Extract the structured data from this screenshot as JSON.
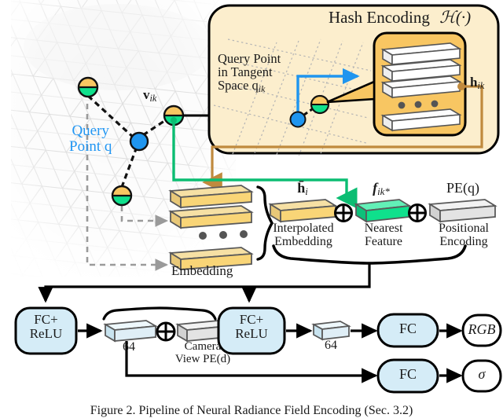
{
  "figure": {
    "caption": "Figure 2.  Pipeline of Neural Radiance Field Encoding (Sec. 3.2)",
    "colors": {
      "hash_panel_fill": "#fceecd",
      "hash_table_fill": "#f8c662",
      "embedding_fill": "#f9d577",
      "nearest_feature_fill": "#0fe08c",
      "positional_fill": "#e3e3e3",
      "fc_fill": "#d5ecf7",
      "feature64_fill": "#dfeef6",
      "query_point_blue": "#1f95ef",
      "vertex_top": "#f8c662",
      "vertex_bottom": "#0fe08c",
      "brown_wire": "#b5823a",
      "green_wire": "#0bbd72",
      "dashed_gray": "#9a9a9a",
      "outline": "#000000"
    }
  },
  "mesh_panel": {
    "query_label_line1": "Query",
    "query_label_line2": "Point q",
    "vertex_label": "v",
    "vertex_label_sub": "ik",
    "embedding_label": "Embedding",
    "ellipsis": "• • •"
  },
  "hash_panel": {
    "title": "Hash Encoding",
    "title_operator": "ℋ(·)",
    "query_tangent_line1": "Query Point",
    "query_tangent_line2": "in Tangent",
    "query_tangent_line3": "Space q",
    "query_tangent_sub": "ik",
    "output_label": "h",
    "output_label_sub": "ik",
    "table_ellipsis": "• • •"
  },
  "features": {
    "interpolated": {
      "symbol": "h̄",
      "symbol_sub": "i",
      "caption_line1": "Interpolated",
      "caption_line2": "Embedding"
    },
    "nearest": {
      "symbol": "f",
      "symbol_sub": "ik*",
      "caption_line1": "Nearest",
      "caption_line2": "Feature"
    },
    "positional": {
      "symbol": "PE(q)",
      "caption_line1": "Positional",
      "caption_line2": "Encoding"
    },
    "plus_symbol": "⊕"
  },
  "network": {
    "fc_relu_1": "FC+\nReLU",
    "fc_relu_1_line1": "FC+",
    "fc_relu_1_line2": "ReLU",
    "fc_relu_2_line1": "FC+",
    "fc_relu_2_line2": "ReLU",
    "hidden_1_label": "64",
    "hidden_2_label": "64",
    "camera_view_line1": "Camera",
    "camera_view_line2": "View PE(d)",
    "plus_symbol": "⊕",
    "fc_rgb": "FC",
    "fc_sigma": "FC",
    "out_rgb": "RGB",
    "out_sigma": "σ"
  }
}
